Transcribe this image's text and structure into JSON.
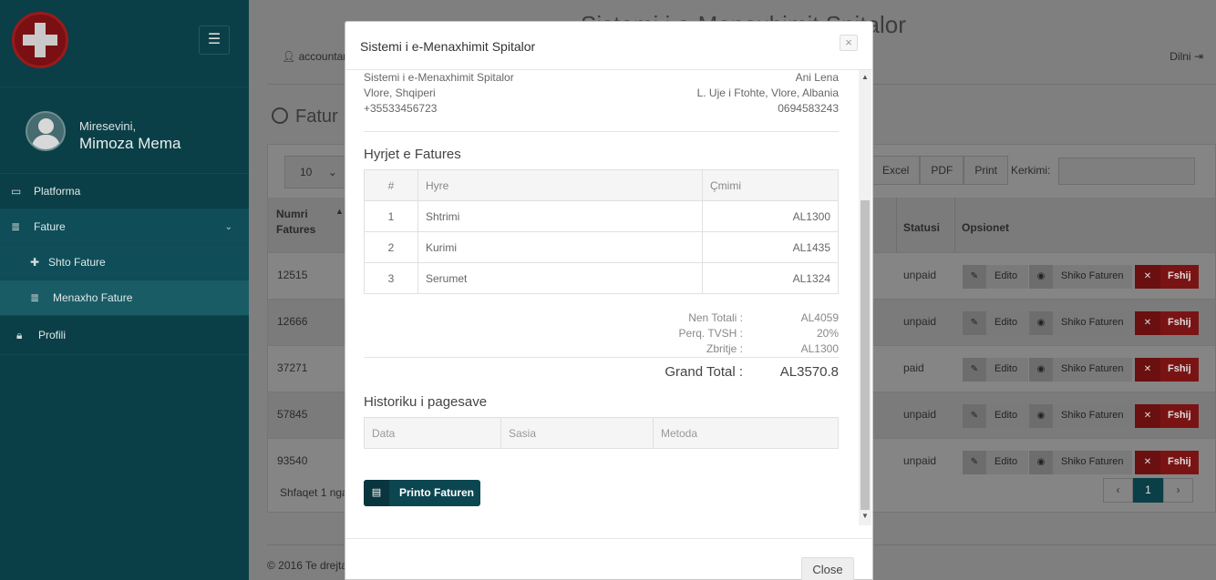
{
  "sidebar": {
    "welcome": "Miresevini,",
    "user_name": "Mimoza Mema",
    "items": [
      {
        "label": "Platforma",
        "icon": "desktop-icon"
      },
      {
        "label": "Fature",
        "icon": "list-icon"
      },
      {
        "label": "Shto Fature",
        "icon": "plus-icon"
      },
      {
        "label": "Menaxho Fature",
        "icon": "list-icon"
      },
      {
        "label": "Profili",
        "icon": "lock-icon"
      }
    ]
  },
  "header": {
    "title": "Sistemi i e-Menaxhimit Spitalor",
    "user": "accountant",
    "logout": "Dilni"
  },
  "page": {
    "heading": "Fatur",
    "length": "10",
    "buttons": [
      "Excel",
      "PDF",
      "Print"
    ],
    "search_label": "Kerkimi:",
    "columns": {
      "number": "Numri Fatures",
      "status": "Statusi",
      "options": "Opsionet"
    },
    "rows": [
      {
        "number": "12515",
        "status": "unpaid"
      },
      {
        "number": "12666",
        "status": "unpaid"
      },
      {
        "number": "37271",
        "status": "paid"
      },
      {
        "number": "57845",
        "status": "unpaid"
      },
      {
        "number": "93540",
        "status": "unpaid"
      }
    ],
    "row_actions": {
      "edit": "Edito",
      "view": "Shiko Faturen",
      "delete": "Fshij"
    },
    "showing": "Shfaqet 1 nga",
    "pager": {
      "prev": "‹",
      "current": "1",
      "next": "›"
    },
    "footer": "© 2016 Te drejta"
  },
  "modal": {
    "title": "Sistemi i e-Menaxhimit Spitalor",
    "from": {
      "name": "Sistemi i e-Menaxhimit Spitalor",
      "address": "Vlore, Shqiperi",
      "phone": "+35533456723"
    },
    "to": {
      "name": "Ani Lena",
      "address": "L. Uje i Ftohte, Vlore, Albania",
      "phone": "0694583243"
    },
    "items_title": "Hyrjet e Fatures",
    "items_headers": {
      "num": "#",
      "entry": "Hyre",
      "price": "Çmimi"
    },
    "items": [
      {
        "num": "1",
        "entry": "Shtrimi",
        "price": "AL1300"
      },
      {
        "num": "2",
        "entry": "Kurimi",
        "price": "AL1435"
      },
      {
        "num": "3",
        "entry": "Serumet",
        "price": "AL1324"
      }
    ],
    "totals": {
      "subtotal_label": "Nen Totali :",
      "subtotal": "AL4059",
      "vat_label": "Perq. TVSH :",
      "vat": "20%",
      "discount_label": "Zbritje :",
      "discount": "AL1300",
      "grand_label": "Grand Total :",
      "grand": "AL3570.8"
    },
    "history_title": "Historiku i pagesave",
    "history_headers": {
      "date": "Data",
      "amount": "Sasia",
      "method": "Metoda"
    },
    "print_label": "Printo Faturen",
    "close_label": "Close"
  },
  "colors": {
    "sidebar": "#0b3f47",
    "accent": "#0c4650",
    "danger": "#7a1414"
  }
}
